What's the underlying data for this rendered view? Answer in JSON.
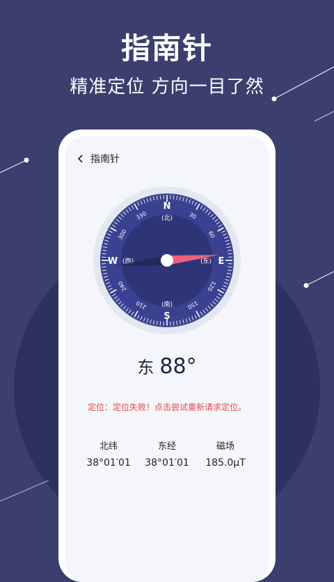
{
  "hero": {
    "title": "指南针",
    "subtitle": "精准定位 方向一目了然"
  },
  "nav": {
    "back_icon": "chevron-left-icon",
    "title": "指南针"
  },
  "compass": {
    "cardinals": {
      "north": "N",
      "east": "E",
      "south": "S",
      "west": "W"
    },
    "cardinal_cn": {
      "north": "(北)",
      "east": "(东)",
      "south": "(南)",
      "west": "(西)"
    },
    "degree_labels": [
      "30",
      "60",
      "120",
      "150",
      "210",
      "240",
      "300",
      "330"
    ],
    "heading_degrees": 88,
    "colors": {
      "dial": "#3a4190",
      "dial_dark": "#2e3577",
      "ring": "#e3e7f1",
      "needle_north": "#f0607a",
      "needle_south": "#25295a"
    }
  },
  "heading": {
    "direction": "东",
    "value": "88°"
  },
  "status": {
    "error": "定位：定位失败！点击尝试重新请求定位。"
  },
  "stats": [
    {
      "label": "北纬",
      "value": "38°01′01"
    },
    {
      "label": "东经",
      "value": "38°01′01"
    },
    {
      "label": "磁场",
      "value": "185.0μT"
    }
  ],
  "colors": {
    "background": "#3a3f6e",
    "circle": "#2c3160",
    "error": "#e5484d"
  }
}
